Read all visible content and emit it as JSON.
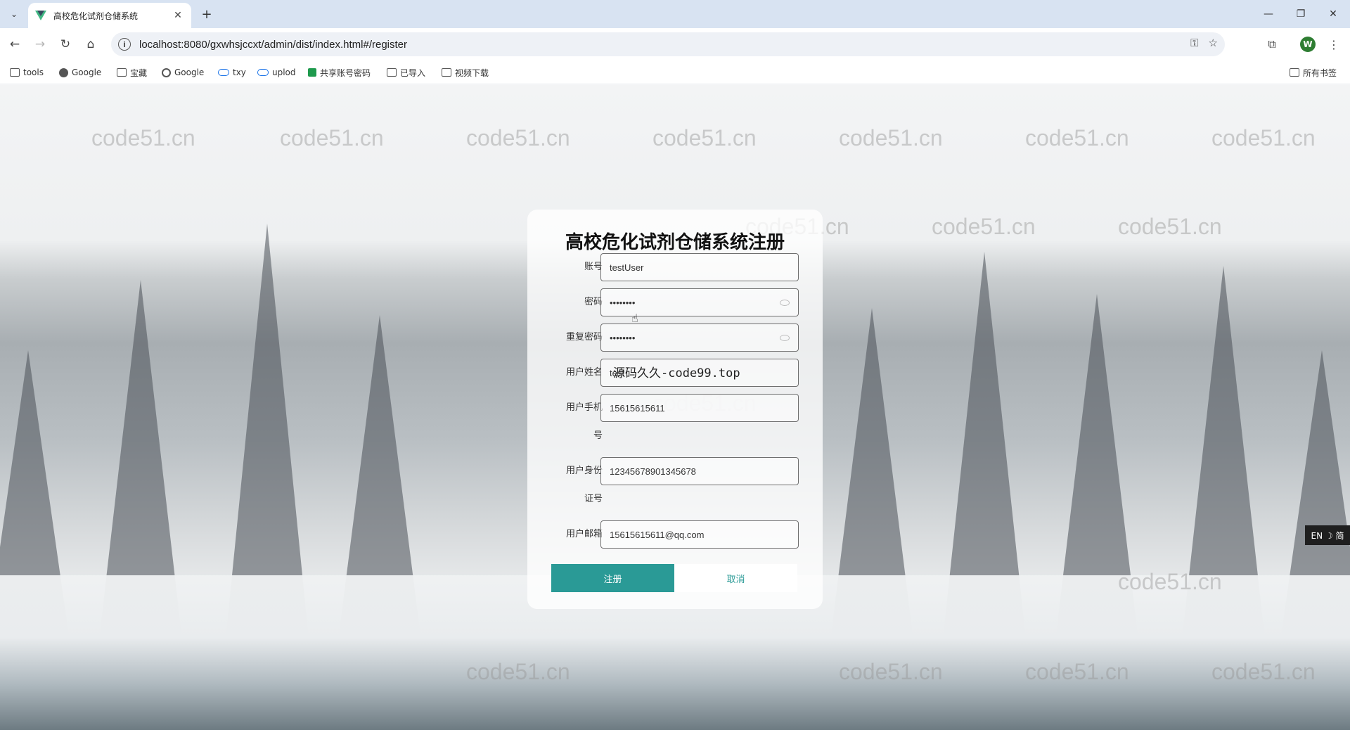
{
  "browser": {
    "tab_title": "高校危化试剂仓储系统",
    "url": "localhost:8080/gxwhsjccxt/admin/dist/index.html#/register",
    "avatar_letter": "W",
    "bookmarks": [
      "tools",
      "Google",
      "宝藏",
      "Google",
      "txy",
      "uplod",
      "共享账号密码",
      "已导入",
      "视频下载"
    ],
    "all_bookmarks": "所有书签"
  },
  "form": {
    "title": "高校危化试剂仓储系统注册",
    "fields": [
      {
        "label": "账号",
        "value": "testUser"
      },
      {
        "label": "密码",
        "value": "••••••••"
      },
      {
        "label": "重复密码",
        "value": "••••••••"
      },
      {
        "label": "用户姓名",
        "value": "test"
      },
      {
        "label": "用户手机号",
        "value": "15615615611"
      },
      {
        "label": "用户身份证号",
        "value": "12345678901345678"
      },
      {
        "label": "用户邮箱",
        "value": "15615615611@qq.com"
      }
    ],
    "register_label": "注册",
    "cancel_label": "取消"
  },
  "overlay": "源码久久-code99.top",
  "watermark": "code51.cn",
  "ime": "EN ☽ 简",
  "colors": {
    "accent": "#2a9a96",
    "tabbar": "#d8e3f2"
  }
}
